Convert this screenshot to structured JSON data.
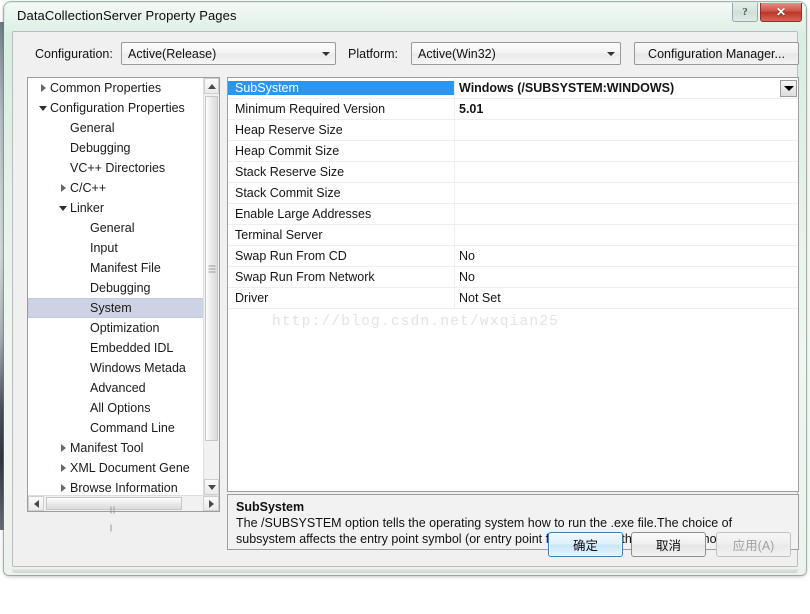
{
  "window": {
    "title": "DataCollectionServer Property Pages",
    "help_button": "?",
    "close_button": "✕"
  },
  "config_bar": {
    "configuration_label": "Configuration:",
    "configuration_value": "Active(Release)",
    "platform_label": "Platform:",
    "platform_value": "Active(Win32)",
    "configuration_manager_button": "Configuration Manager..."
  },
  "tree": {
    "items": [
      {
        "label": "Common Properties",
        "indent": 0,
        "arrow": "closed",
        "selected": false
      },
      {
        "label": "Configuration Properties",
        "indent": 0,
        "arrow": "open",
        "selected": false
      },
      {
        "label": "General",
        "indent": 1,
        "arrow": "none",
        "selected": false
      },
      {
        "label": "Debugging",
        "indent": 1,
        "arrow": "none",
        "selected": false
      },
      {
        "label": "VC++ Directories",
        "indent": 1,
        "arrow": "none",
        "selected": false
      },
      {
        "label": "C/C++",
        "indent": 1,
        "arrow": "closed",
        "selected": false
      },
      {
        "label": "Linker",
        "indent": 1,
        "arrow": "open",
        "selected": false
      },
      {
        "label": "General",
        "indent": 2,
        "arrow": "none",
        "selected": false
      },
      {
        "label": "Input",
        "indent": 2,
        "arrow": "none",
        "selected": false
      },
      {
        "label": "Manifest File",
        "indent": 2,
        "arrow": "none",
        "selected": false
      },
      {
        "label": "Debugging",
        "indent": 2,
        "arrow": "none",
        "selected": false
      },
      {
        "label": "System",
        "indent": 2,
        "arrow": "none",
        "selected": true
      },
      {
        "label": "Optimization",
        "indent": 2,
        "arrow": "none",
        "selected": false
      },
      {
        "label": "Embedded IDL",
        "indent": 2,
        "arrow": "none",
        "selected": false
      },
      {
        "label": "Windows Metada",
        "indent": 2,
        "arrow": "none",
        "selected": false
      },
      {
        "label": "Advanced",
        "indent": 2,
        "arrow": "none",
        "selected": false
      },
      {
        "label": "All Options",
        "indent": 2,
        "arrow": "none",
        "selected": false
      },
      {
        "label": "Command Line",
        "indent": 2,
        "arrow": "none",
        "selected": false
      },
      {
        "label": "Manifest Tool",
        "indent": 1,
        "arrow": "closed",
        "selected": false
      },
      {
        "label": "XML Document Gene",
        "indent": 1,
        "arrow": "closed",
        "selected": false
      },
      {
        "label": "Browse Information",
        "indent": 1,
        "arrow": "closed",
        "selected": false
      }
    ]
  },
  "property_grid": {
    "rows": [
      {
        "name": "SubSystem",
        "value": "Windows (/SUBSYSTEM:WINDOWS)",
        "bold": true,
        "selected": true
      },
      {
        "name": "Minimum Required Version",
        "value": "5.01",
        "bold": true,
        "selected": false
      },
      {
        "name": "Heap Reserve Size",
        "value": "",
        "bold": false,
        "selected": false
      },
      {
        "name": "Heap Commit Size",
        "value": "",
        "bold": false,
        "selected": false
      },
      {
        "name": "Stack Reserve Size",
        "value": "",
        "bold": false,
        "selected": false
      },
      {
        "name": "Stack Commit Size",
        "value": "",
        "bold": false,
        "selected": false
      },
      {
        "name": "Enable Large Addresses",
        "value": "",
        "bold": false,
        "selected": false
      },
      {
        "name": "Terminal Server",
        "value": "",
        "bold": false,
        "selected": false
      },
      {
        "name": "Swap Run From CD",
        "value": "No",
        "bold": false,
        "selected": false
      },
      {
        "name": "Swap Run From Network",
        "value": "No",
        "bold": false,
        "selected": false
      },
      {
        "name": "Driver",
        "value": "Not Set",
        "bold": false,
        "selected": false
      }
    ],
    "watermark": "http://blog.csdn.net/wxqian25"
  },
  "description": {
    "title": "SubSystem",
    "body": "The /SUBSYSTEM option tells the operating system how to run the .exe file.The choice of subsystem affects the entry point symbol (or entry point function) that the linker will choose."
  },
  "buttons": {
    "ok": "确定",
    "cancel": "取消",
    "apply": "应用(A)"
  },
  "colors": {
    "title_bar": "#dcefe3",
    "close_button": "#bb3526",
    "prop_selected": "#2b96f0",
    "tree_selected": "#cdd3e5"
  }
}
